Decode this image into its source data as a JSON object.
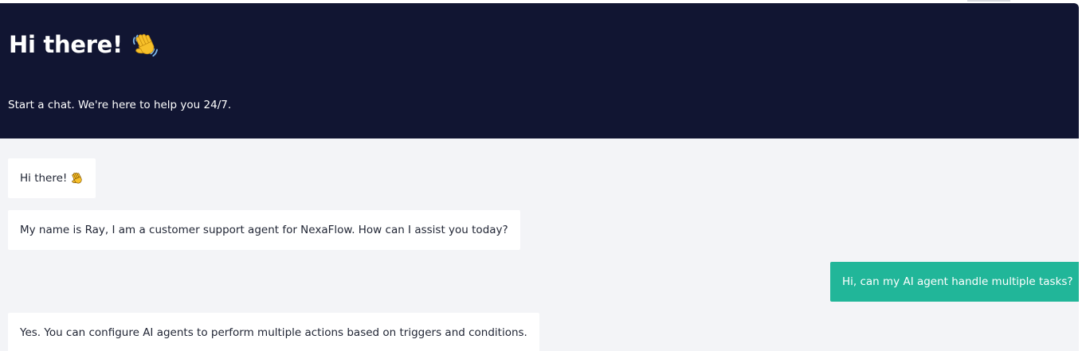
{
  "header": {
    "title": "Hi there!",
    "title_icon": "waving-hand-icon",
    "subtitle": "Start a chat. We're here to help you 24/7."
  },
  "messages": [
    {
      "sender": "agent",
      "text": "Hi there!",
      "icon": "waving-hand-icon"
    },
    {
      "sender": "agent",
      "text": "My name is Ray, I am a customer support agent for NexaFlow. How can I assist you today?"
    },
    {
      "sender": "user",
      "text": "Hi, can my AI agent handle multiple tasks?"
    },
    {
      "sender": "agent",
      "text": "Yes. You can configure AI agents to perform multiple actions based on triggers and conditions."
    }
  ],
  "colors": {
    "header_bg": "#111532",
    "chat_bg": "#f3f4f7",
    "user_bubble": "#21b699",
    "agent_bubble": "#ffffff"
  }
}
